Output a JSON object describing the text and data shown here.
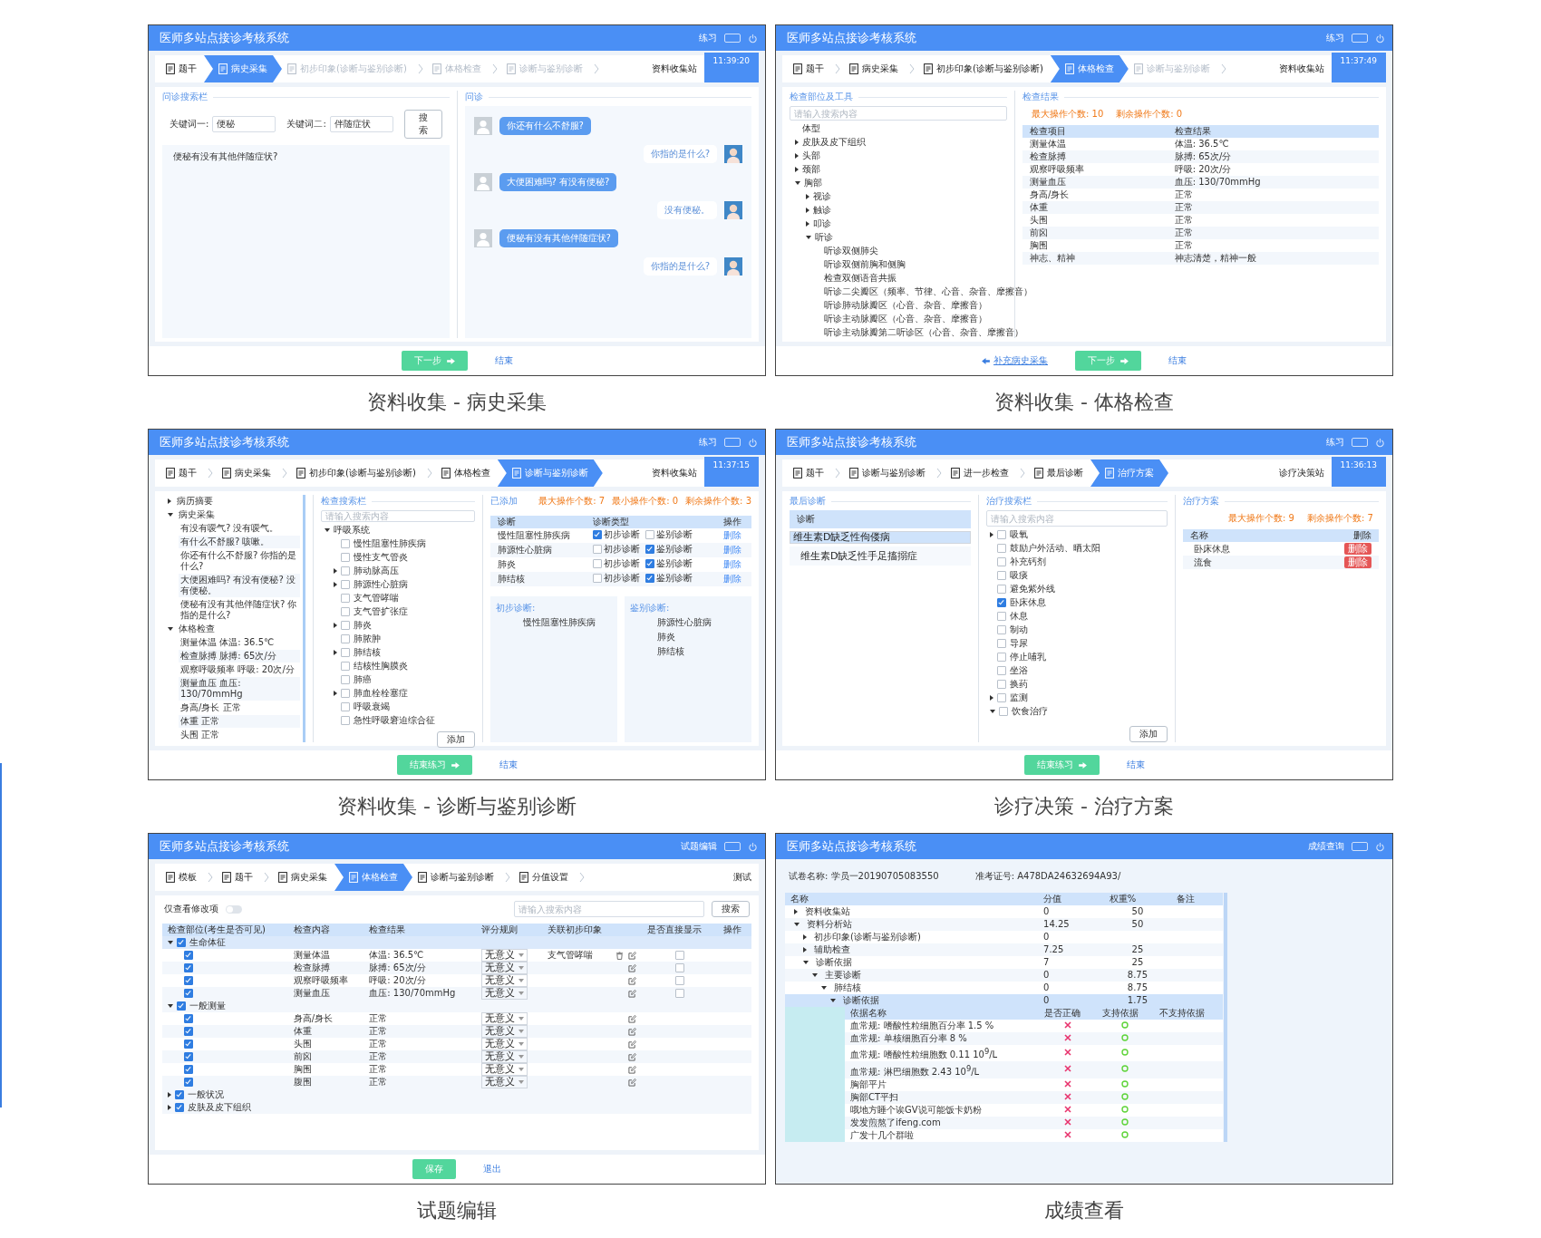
{
  "panels": [
    {
      "caption": "资料收集 - 病史采集",
      "header": {
        "title": "医师多站点接诊考核系统",
        "mode": "练习"
      },
      "steps": [
        {
          "label": "题干",
          "selected": false,
          "disabled": false
        },
        {
          "label": "病史采集",
          "selected": true,
          "disabled": false
        },
        {
          "label": "初步印象(诊断与鉴别诊断)",
          "selected": false,
          "disabled": true
        },
        {
          "label": "体格检查",
          "selected": false,
          "disabled": true
        },
        {
          "label": "诊断与鉴别诊断",
          "selected": false,
          "disabled": true
        }
      ],
      "station": "资料收集站",
      "time": "11:39:20",
      "body": {
        "kind": "history",
        "search": {
          "title": "问诊搜索栏",
          "fields": [
            {
              "label": "关键词一:",
              "value": "便秘"
            },
            {
              "label": "关键词二:",
              "value": "伴随症状"
            }
          ],
          "button": "搜索",
          "results": [
            "便秘有没有其他伴随症状?"
          ]
        },
        "chat": {
          "title": "问诊",
          "messages": [
            {
              "kind": "doctor",
              "text": "你还有什么不舒服?"
            },
            {
              "kind": "patient",
              "text": "你指的是什么?"
            },
            {
              "kind": "doctor",
              "text": "大便困难吗? 有没有便秘?"
            },
            {
              "kind": "patient",
              "text": "没有便秘。"
            },
            {
              "kind": "doctor",
              "text": "便秘有没有其他伴随症状?"
            },
            {
              "kind": "patient",
              "text": "你指的是什么?"
            }
          ]
        }
      },
      "footer": [
        {
          "kind": "next",
          "label": "下一步"
        },
        {
          "kind": "link",
          "label": "结束"
        }
      ]
    },
    {
      "caption": "资料收集 - 体格检查",
      "header": {
        "title": "医师多站点接诊考核系统",
        "mode": "练习"
      },
      "steps": [
        {
          "label": "题干",
          "selected": false,
          "disabled": false
        },
        {
          "label": "病史采集",
          "selected": false,
          "disabled": false
        },
        {
          "label": "初步印象(诊断与鉴别诊断)",
          "selected": false,
          "disabled": false
        },
        {
          "label": "体格检查",
          "selected": true,
          "disabled": false
        },
        {
          "label": "诊断与鉴别诊断",
          "selected": false,
          "disabled": true
        }
      ],
      "station": "资料收集站",
      "time": "11:37:49",
      "body": {
        "kind": "exam",
        "left": {
          "title": "检查部位及工具",
          "placeholder": "请输入搜索内容",
          "tree": [
            {
              "label": "体型"
            },
            {
              "label": "皮肤及皮下组织",
              "expanded": false
            },
            {
              "label": "头部",
              "expanded": false
            },
            {
              "label": "颈部",
              "expanded": false
            },
            {
              "label": "胸部",
              "expanded": true,
              "children": [
                {
                  "label": "视诊",
                  "expanded": false
                },
                {
                  "label": "触诊",
                  "expanded": false
                },
                {
                  "label": "叩诊",
                  "expanded": false
                },
                {
                  "label": "听诊",
                  "expanded": true,
                  "children": [
                    {
                      "label": "听诊双侧肺尖"
                    },
                    {
                      "label": "听诊双侧前胸和侧胸"
                    },
                    {
                      "label": "检查双侧语音共振"
                    },
                    {
                      "label": "听诊二尖瓣区（频率、节律、心音、杂音、摩擦音）"
                    },
                    {
                      "label": "听诊肺动脉瓣区（心音、杂音、摩擦音）"
                    },
                    {
                      "label": "听诊主动脉瓣区（心音、杂音、摩擦音）"
                    },
                    {
                      "label": "听诊主动脉瓣第二听诊区（心音、杂音、摩擦音）"
                    }
                  ]
                }
              ]
            }
          ]
        },
        "right": {
          "title": "检查结果",
          "counters": [
            "最大操作个数: 10",
            "剩余操作个数: 0"
          ],
          "columns": [
            "检查项目",
            "检查结果"
          ],
          "rows": [
            [
              "测量体温",
              "体温: 36.5℃"
            ],
            [
              "检查脉搏",
              "脉搏: 65次/分"
            ],
            [
              "观察呼吸频率",
              "呼吸: 20次/分"
            ],
            [
              "测量血压",
              "血压: 130/70mmHg"
            ],
            [
              "身高/身长",
              "正常"
            ],
            [
              "体重",
              "正常"
            ],
            [
              "头围",
              "正常"
            ],
            [
              "前囟",
              "正常"
            ],
            [
              "胸围",
              "正常"
            ],
            [
              "神志、精神",
              "神志清楚，精神一般"
            ]
          ]
        }
      },
      "footer": [
        {
          "kind": "back",
          "label": "补充病史采集"
        },
        {
          "kind": "next",
          "label": "下一步"
        },
        {
          "kind": "link",
          "label": "结束"
        }
      ]
    },
    {
      "caption": "资料收集 - 诊断与鉴别诊断",
      "header": {
        "title": "医师多站点接诊考核系统",
        "mode": "练习"
      },
      "steps": [
        {
          "label": "题干",
          "selected": false,
          "disabled": false
        },
        {
          "label": "病史采集",
          "selected": false,
          "disabled": false
        },
        {
          "label": "初步印象(诊断与鉴别诊断)",
          "selected": false,
          "disabled": false
        },
        {
          "label": "体格检查",
          "selected": false,
          "disabled": false
        },
        {
          "label": "诊断与鉴别诊断",
          "selected": true,
          "disabled": false
        }
      ],
      "station": "资料收集站",
      "time": "11:37:15",
      "body": {
        "kind": "diagnosis",
        "outline": [
          {
            "label": "病历摘要",
            "expanded": false
          },
          {
            "label": "病史采集",
            "expanded": true,
            "children": [
              {
                "label": "有没有嗳气? 没有嗳气。"
              },
              {
                "label": "有什么不舒服? 咳嗽。"
              },
              {
                "label": "你还有什么不舒服? 你指的是什么?"
              },
              {
                "label": "大便困难吗? 有没有便秘? 没有便秘。"
              },
              {
                "label": "便秘有没有其他伴随症状? 你指的是什么?"
              }
            ]
          },
          {
            "label": "体格检查",
            "expanded": true,
            "children": [
              {
                "label": "测量体温 体温: 36.5℃"
              },
              {
                "label": "检查脉搏 脉搏: 65次/分"
              },
              {
                "label": "观察呼吸频率 呼吸: 20次/分"
              },
              {
                "label": "测量血压 血压: 130/70mmHg"
              },
              {
                "label": "身高/身长 正常"
              },
              {
                "label": "体重 正常"
              },
              {
                "label": "头围 正常"
              }
            ]
          }
        ],
        "middle": {
          "title": "检查搜索栏",
          "placeholder": "请输入搜索内容",
          "tree": [
            {
              "label": "呼吸系统",
              "expanded": true,
              "children": [
                {
                  "label": "慢性阻塞性肺疾病",
                  "checked": false
                },
                {
                  "label": "慢性支气管炎",
                  "checked": false
                },
                {
                  "label": "肺动脉高压",
                  "checked": false,
                  "expanded": false
                },
                {
                  "label": "肺源性心脏病",
                  "checked": false,
                  "expanded": false
                },
                {
                  "label": "支气管哮喘",
                  "checked": false
                },
                {
                  "label": "支气管扩张症",
                  "checked": false
                },
                {
                  "label": "肺炎",
                  "checked": false,
                  "expanded": false
                },
                {
                  "label": "肺脓肿",
                  "checked": false
                },
                {
                  "label": "肺结核",
                  "checked": false,
                  "expanded": false
                },
                {
                  "label": "结核性胸膜炎",
                  "checked": false
                },
                {
                  "label": "肺癌",
                  "checked": false
                },
                {
                  "label": "肺血栓栓塞症",
                  "checked": false,
                  "expanded": false
                },
                {
                  "label": "呼吸衰竭",
                  "checked": false
                },
                {
                  "label": "急性呼吸窘迫综合征",
                  "checked": false
                }
              ]
            }
          ],
          "button": "添加"
        },
        "right": {
          "title": "已添加",
          "counters": [
            "最大操作个数: 7",
            "最小操作个数: 0",
            "剩余操作个数: 3"
          ],
          "columns": [
            "诊断",
            "诊断类型",
            "操作"
          ],
          "rows": [
            {
              "name": "慢性阻塞性肺疾病",
              "types": [
                {
                  "label": "初步诊断",
                  "checked": true
                },
                {
                  "label": "鉴别诊断",
                  "checked": false
                }
              ],
              "action": "删除"
            },
            {
              "name": "肺源性心脏病",
              "types": [
                {
                  "label": "初步诊断",
                  "checked": false
                },
                {
                  "label": "鉴别诊断",
                  "checked": true
                }
              ],
              "action": "删除"
            },
            {
              "name": "肺炎",
              "types": [
                {
                  "label": "初步诊断",
                  "checked": false
                },
                {
                  "label": "鉴别诊断",
                  "checked": true
                }
              ],
              "action": "删除"
            },
            {
              "name": "肺结核",
              "types": [
                {
                  "label": "初步诊断",
                  "checked": false
                },
                {
                  "label": "鉴别诊断",
                  "checked": true
                }
              ],
              "action": "删除"
            }
          ],
          "boxes": [
            {
              "title": "初步诊断:",
              "items": [
                "慢性阻塞性肺疾病"
              ]
            },
            {
              "title": "鉴别诊断:",
              "items": [
                "肺源性心脏病",
                "肺炎",
                "肺结核"
              ]
            }
          ]
        }
      },
      "footer": [
        {
          "kind": "next",
          "label": "结束练习"
        },
        {
          "kind": "link",
          "label": "结束"
        }
      ]
    },
    {
      "caption": "诊疗决策 - 治疗方案",
      "header": {
        "title": "医师多站点接诊考核系统",
        "mode": "练习"
      },
      "steps": [
        {
          "label": "题干",
          "selected": false,
          "disabled": false
        },
        {
          "label": "诊断与鉴别诊断",
          "selected": false,
          "disabled": false
        },
        {
          "label": "进一步检查",
          "selected": false,
          "disabled": false
        },
        {
          "label": "最后诊断",
          "selected": false,
          "disabled": false
        },
        {
          "label": "治疗方案",
          "selected": true,
          "disabled": false
        }
      ],
      "station": "诊疗决策站",
      "time": "11:36:13",
      "body": {
        "kind": "treatment",
        "left": {
          "title": "最后诊断",
          "header": "诊断",
          "items": [
            {
              "label": "维生素D缺乏性佝偻病",
              "selected": true
            },
            {
              "label": "维生素D缺乏性手足搐搦症",
              "selected": false
            }
          ]
        },
        "middle": {
          "title": "治疗搜索栏",
          "placeholder": "请输入搜索内容",
          "tree": [
            {
              "label": "吸氧",
              "checked": false,
              "expanded": false
            },
            {
              "label": "鼓励户外活动、晒太阳",
              "checked": false
            },
            {
              "label": "补充钙剂",
              "checked": false
            },
            {
              "label": "吸痰",
              "checked": false
            },
            {
              "label": "避免紫外线",
              "checked": false
            },
            {
              "label": "卧床休息",
              "checked": true
            },
            {
              "label": "休息",
              "checked": false
            },
            {
              "label": "制动",
              "checked": false
            },
            {
              "label": "导尿",
              "checked": false
            },
            {
              "label": "停止哺乳",
              "checked": false
            },
            {
              "label": "坐浴",
              "checked": false
            },
            {
              "label": "换药",
              "checked": false
            },
            {
              "label": "监测",
              "checked": false,
              "expanded": false
            },
            {
              "label": "饮食治疗",
              "checked": false,
              "expanded": true
            }
          ],
          "button": "添加"
        },
        "right": {
          "title": "治疗方案",
          "counters": [
            "最大操作个数: 9",
            "剩余操作个数: 7"
          ],
          "columns": [
            "名称",
            "删除"
          ],
          "rows": [
            {
              "name": "卧床休息",
              "action": "删除"
            },
            {
              "name": "流食",
              "action": "删除"
            }
          ]
        }
      },
      "footer": [
        {
          "kind": "next",
          "label": "结束练习"
        },
        {
          "kind": "link",
          "label": "结束"
        }
      ]
    },
    {
      "caption": "试题编辑",
      "header": {
        "title": "医师多站点接诊考核系统",
        "mode": "试题编辑"
      },
      "steps": [
        {
          "label": "模板",
          "selected": false,
          "disabled": false
        },
        {
          "label": "题干",
          "selected": false,
          "disabled": false
        },
        {
          "label": "病史采集",
          "selected": false,
          "disabled": false
        },
        {
          "label": "体格检查",
          "selected": true,
          "disabled": false
        },
        {
          "label": "诊断与鉴别诊断",
          "selected": false,
          "disabled": false
        },
        {
          "label": "分值设置",
          "selected": false,
          "disabled": false
        }
      ],
      "station": "测试",
      "body": {
        "kind": "edit",
        "toggle": {
          "label": "仅查看修改项",
          "on": false
        },
        "placeholder": "请输入搜索内容",
        "button": "搜索",
        "columns": [
          "检查部位(考生是否可见)",
          "检查内容",
          "检查结果",
          "评分规则",
          "关联初步印象",
          "是否直接显示",
          "操作"
        ],
        "groups": [
          {
            "label": "生命体征",
            "checked": true,
            "expanded": true,
            "rows": [
              {
                "checked": true,
                "item": "测量体温",
                "result": "体温: 36.5℃",
                "rule": "无意义",
                "link": "支气管哮喘",
                "direct_display": false
              },
              {
                "checked": true,
                "item": "检查脉搏",
                "result": "脉搏: 65次/分",
                "rule": "无意义",
                "direct_display": false
              },
              {
                "checked": true,
                "item": "观察呼吸频率",
                "result": "呼吸: 20次/分",
                "rule": "无意义",
                "direct_display": false
              },
              {
                "checked": true,
                "item": "测量血压",
                "result": "血压: 130/70mmHg",
                "rule": "无意义",
                "direct_display": false
              }
            ]
          },
          {
            "label": "一般测量",
            "checked": true,
            "expanded": true,
            "rows": [
              {
                "checked": true,
                "item": "身高/身长",
                "result": "正常",
                "rule": "无意义"
              },
              {
                "checked": true,
                "item": "体重",
                "result": "正常",
                "rule": "无意义"
              },
              {
                "checked": true,
                "item": "头围",
                "result": "正常",
                "rule": "无意义"
              },
              {
                "checked": true,
                "item": "前囟",
                "result": "正常",
                "rule": "无意义"
              },
              {
                "checked": true,
                "item": "胸围",
                "result": "正常",
                "rule": "无意义"
              },
              {
                "checked": true,
                "item": "腹围",
                "result": "正常",
                "rule": "无意义"
              }
            ]
          },
          {
            "label": "一般状况",
            "checked": true,
            "expanded": false
          },
          {
            "label": "皮肤及皮下组织",
            "checked": true,
            "expanded": false
          }
        ]
      },
      "footer": [
        {
          "kind": "save",
          "label": "保存"
        },
        {
          "kind": "link",
          "label": "退出"
        }
      ]
    },
    {
      "caption": "成绩查看",
      "header": {
        "title": "医师多站点接诊考核系统",
        "mode": "成绩查询"
      },
      "body": {
        "kind": "score",
        "info": [
          "试卷名称: 学员一20190705083550",
          "准考证号: A478DA24632694A93/"
        ],
        "columns": [
          "名称",
          "分值",
          "权重%",
          "备注"
        ],
        "tree": [
          {
            "name": "资料收集站",
            "score": "0",
            "weight": "50",
            "expanded": false,
            "selected": false
          },
          {
            "name": "资料分析站",
            "score": "14.25",
            "weight": "50",
            "expanded": true,
            "selected": false,
            "children": [
              {
                "name": "初步印象(诊断与鉴别诊断)",
                "score": "0",
                "expanded": false,
                "selected": false
              },
              {
                "name": "辅助检查",
                "score": "7.25",
                "weight": "25",
                "expanded": false,
                "selected": false
              },
              {
                "name": "诊断依据",
                "score": "7",
                "weight": "25",
                "expanded": true,
                "selected": false,
                "children": [
                  {
                    "name": "主要诊断",
                    "score": "0",
                    "weight": "8.75",
                    "expanded": true,
                    "selected": false,
                    "children": [
                      {
                        "name": "肺结核",
                        "score": "0",
                        "weight": "8.75",
                        "expanded": true,
                        "selected": false,
                        "children": [
                          {
                            "name": "诊断依据",
                            "score": "0",
                            "weight": "1.75",
                            "expanded": true,
                            "selected": true,
                            "basis": {
                              "columns": [
                                "依据名称",
                                "是否正确",
                                "支持依据",
                                "不支持依据"
                              ],
                              "rows": [
                                {
                                  "name": "血常规: 嗜酸性粒细胞百分率 1.5 %",
                                  "correct": false,
                                  "supported": true
                                },
                                {
                                  "name": "血常规: 单核细胞百分率 8 %",
                                  "correct": false,
                                  "supported": true
                                },
                                {
                                  "name": "血常规: 嗜酸性粒细胞数 0.11 10$^{9}$/L",
                                  "correct": false,
                                  "supported": true
                                },
                                {
                                  "name": "血常规: 淋巴细胞数 2.43 10$^{9}$/L",
                                  "correct": false,
                                  "supported": true
                                },
                                {
                                  "name": "胸部平片",
                                  "correct": false,
                                  "supported": true
                                },
                                {
                                  "name": "胸部CT平扫",
                                  "correct": false,
                                  "supported": true
                                },
                                {
                                  "name": "哦地方睡个诶GV说可能饭卡奶粉",
                                  "correct": false,
                                  "supported": true
                                },
                                {
                                  "name": "发发煎熬了ifeng.com",
                                  "correct": false,
                                  "supported": true
                                },
                                {
                                  "name": "广发十几个群啦",
                                  "correct": false,
                                  "supported": true
                                }
                              ]
                            }
                          }
                        ]
                      }
                    ]
                  }
                ]
              }
            ]
          }
        ]
      }
    }
  ]
}
